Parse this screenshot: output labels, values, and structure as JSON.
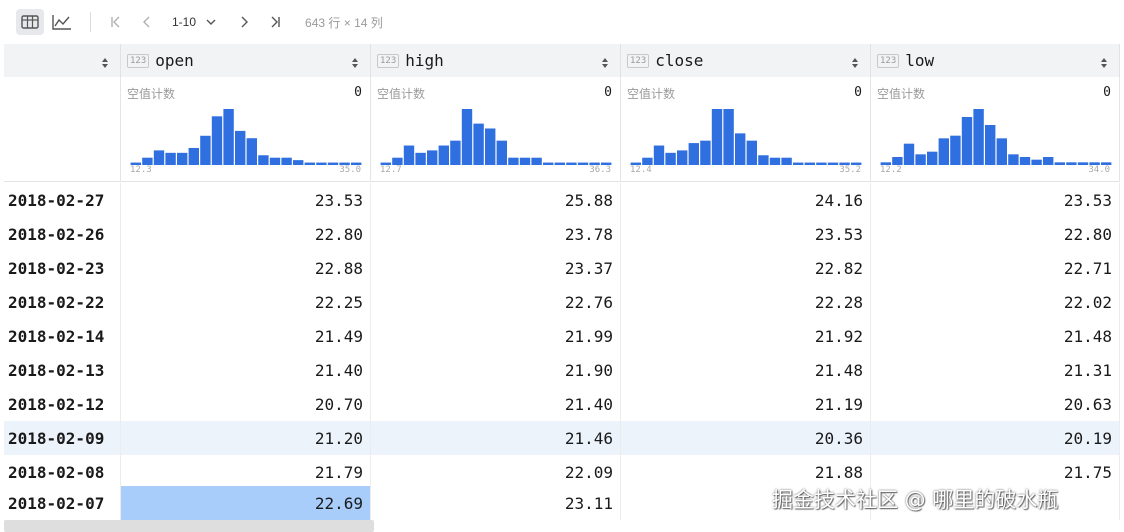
{
  "toolbar": {
    "page_range": "1-10",
    "rows_info": "643 行 × 14 列"
  },
  "table": {
    "columns": [
      {
        "name": "open",
        "type": "123",
        "null_label": "空值计数",
        "null_count": "0",
        "hist_min": "12.3",
        "hist_max": "35.0",
        "hist": [
          1,
          3,
          6,
          5,
          5,
          7,
          12,
          20,
          23,
          14,
          11,
          4,
          3,
          3,
          2,
          1,
          1,
          1,
          1,
          1
        ]
      },
      {
        "name": "high",
        "type": "123",
        "null_label": "空值计数",
        "null_count": "0",
        "hist_min": "12.7",
        "hist_max": "36.3",
        "hist": [
          1,
          3,
          8,
          5,
          6,
          8,
          10,
          23,
          17,
          15,
          10,
          3,
          3,
          3,
          1,
          1,
          1,
          1,
          1,
          1
        ]
      },
      {
        "name": "close",
        "type": "123",
        "null_label": "空值计数",
        "null_count": "0",
        "hist_min": "12.4",
        "hist_max": "35.2",
        "hist": [
          1,
          3,
          8,
          5,
          6,
          9,
          10,
          23,
          23,
          13,
          10,
          4,
          3,
          3,
          1,
          1,
          1,
          1,
          1,
          1
        ]
      },
      {
        "name": "low",
        "type": "123",
        "null_label": "空值计数",
        "null_count": "0",
        "hist_min": "12.2",
        "hist_max": "34.0",
        "hist": [
          1,
          3,
          8,
          4,
          5,
          10,
          11,
          18,
          21,
          15,
          10,
          4,
          3,
          2,
          3,
          1,
          1,
          1,
          1,
          1
        ]
      }
    ],
    "rows": [
      {
        "date": "2018-02-27",
        "open": "23.53",
        "high": "25.88",
        "close": "24.16",
        "low": "23.53"
      },
      {
        "date": "2018-02-26",
        "open": "22.80",
        "high": "23.78",
        "close": "23.53",
        "low": "22.80"
      },
      {
        "date": "2018-02-23",
        "open": "22.88",
        "high": "23.37",
        "close": "22.82",
        "low": "22.71"
      },
      {
        "date": "2018-02-22",
        "open": "22.25",
        "high": "22.76",
        "close": "22.28",
        "low": "22.02"
      },
      {
        "date": "2018-02-14",
        "open": "21.49",
        "high": "21.99",
        "close": "21.92",
        "low": "21.48"
      },
      {
        "date": "2018-02-13",
        "open": "21.40",
        "high": "21.90",
        "close": "21.48",
        "low": "21.31"
      },
      {
        "date": "2018-02-12",
        "open": "20.70",
        "high": "21.40",
        "close": "21.19",
        "low": "20.63"
      },
      {
        "date": "2018-02-09",
        "open": "21.20",
        "high": "21.46",
        "close": "20.36",
        "low": "20.19"
      },
      {
        "date": "2018-02-08",
        "open": "21.79",
        "high": "22.09",
        "close": "21.88",
        "low": "21.75"
      },
      {
        "date": "2018-02-07",
        "open": "22.69",
        "high": "23.11",
        "close": "",
        "low": ""
      }
    ],
    "highlighted_row": 7,
    "selected_cell": {
      "row": 9,
      "col": "open"
    }
  },
  "colors": {
    "histogram_bar": "#2f6fe0",
    "selected_cell": "#a9cdfb",
    "highlighted_row": "#edf3fb",
    "header_bg": "#f2f3f5"
  },
  "watermark": "掘金技术社区 @ 哪里的破水瓶"
}
